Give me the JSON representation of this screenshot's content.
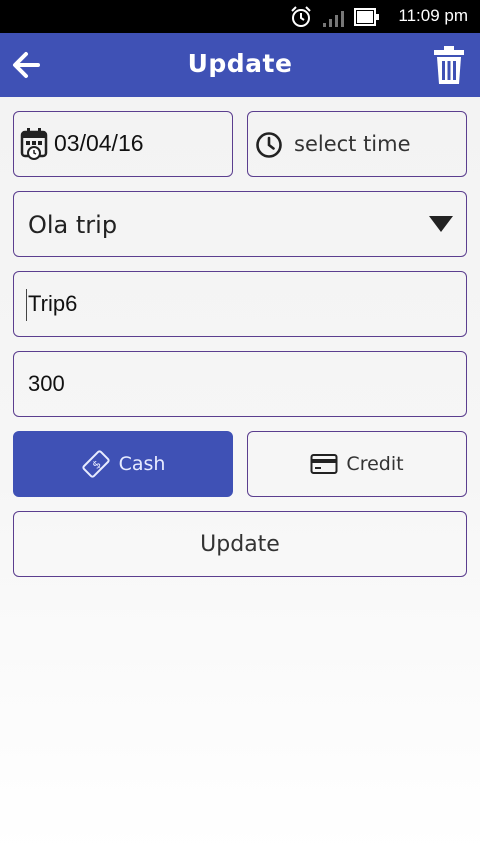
{
  "status_bar": {
    "time": "11:09 pm",
    "icons": [
      "alarm-icon",
      "signal-icon",
      "battery-icon"
    ]
  },
  "app_bar": {
    "title": "Update",
    "back_icon": "arrow-left-icon",
    "delete_icon": "trash-icon",
    "color": "#3f51b5"
  },
  "form": {
    "date": "03/04/16",
    "time_placeholder": "select time",
    "category": "Ola trip",
    "title": "Trip6",
    "amount": "300"
  },
  "payment": {
    "cash_label": "Cash",
    "credit_label": "Credit",
    "selected": "Cash"
  },
  "update_button": "Update",
  "colors": {
    "primary": "#3f51b5",
    "field_border": "#5b3e8f"
  }
}
